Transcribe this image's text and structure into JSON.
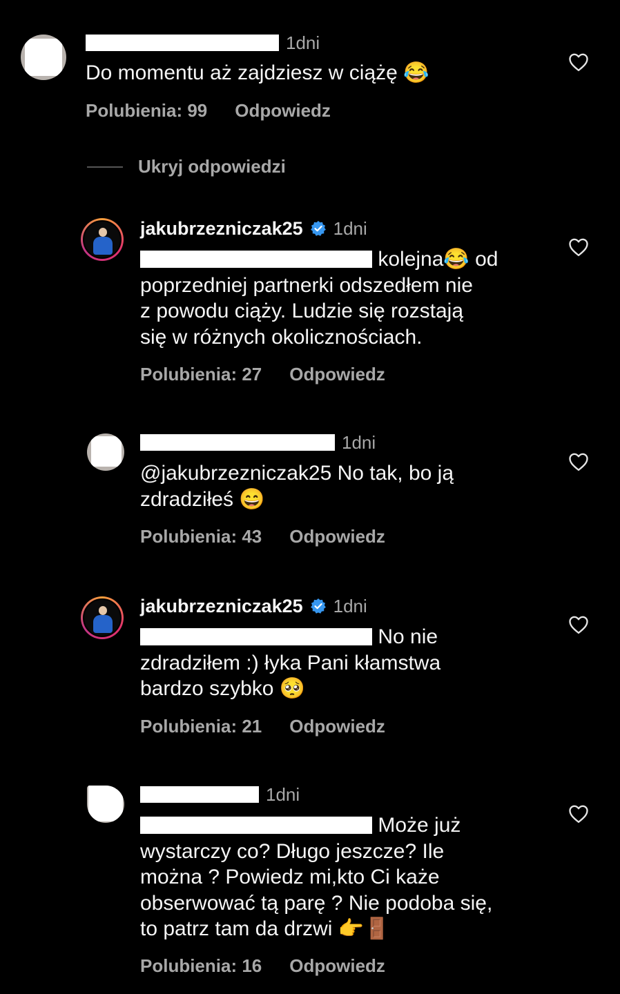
{
  "comments": [
    {
      "time": "1dni",
      "text": "Do momentu aż zajdziesz w ciążę",
      "emoji": "😂",
      "likes": "Polubienia: 99",
      "reply": "Odpowiedz"
    },
    {
      "username": "jakubrzezniczak25",
      "time": "1dni",
      "line1_after": "kolejna",
      "line1_emoji": "😂",
      "line1_end": "od",
      "lines": "poprzedniej partnerki odszedłem nie\nz powodu ciąży. Ludzie się rozstają\nsię w różnych okolicznościach.",
      "likes": "Polubienia: 27",
      "reply": "Odpowiedz"
    },
    {
      "time": "1dni",
      "text": "@jakubrzezniczak25 No tak, bo ją\nzdradziłeś",
      "emoji": "😄",
      "likes": "Polubienia: 43",
      "reply": "Odpowiedz"
    },
    {
      "username": "jakubrzezniczak25",
      "time": "1dni",
      "line1_after": "No nie",
      "lines": "zdradziłem :) łyka Pani kłamstwa\nbardzo szybko",
      "emoji": "🥺",
      "likes": "Polubienia: 21",
      "reply": "Odpowiedz"
    },
    {
      "time": "1dni",
      "line1_after": "Może już",
      "lines": "wystarczy co? Długo jeszcze? Ile\nmożna ? Powiedz mi,kto Ci każe\nobserwować tą parę ? Nie podoba się,\nto patrz tam da drzwi",
      "emoji": "👉🚪",
      "likes": "Polubienia: 16",
      "reply": "Odpowiedz"
    }
  ],
  "hide_replies": "Ukryj odpowiedzi",
  "icons": {
    "heart": "heart-outline-icon",
    "verified": "verified-badge-icon"
  },
  "colors": {
    "background": "#000000",
    "text": "#f5f5f5",
    "muted": "#a8a8a8",
    "verified": "#3797f0"
  }
}
